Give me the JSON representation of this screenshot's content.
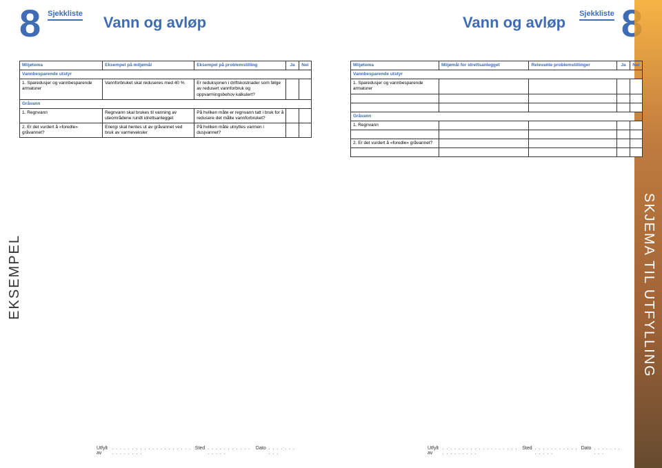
{
  "chapter_number": "8",
  "sjekkliste_label": "Sjekkliste",
  "page_title": "Vann og avløp",
  "vertical_left": "EKSEMPEL",
  "vertical_right": "SKJEMA TIL UTFYLLING",
  "left_table": {
    "headers": {
      "c1": "Miljøtema",
      "c2": "Eksempel på miljømål",
      "c3": "Eksempel på problemstilling",
      "ja": "Ja",
      "nei": "Nei"
    },
    "section1": "Vannbesparende utstyr",
    "rows1": [
      {
        "c1": "1. Sparedusjer og vannbesparende armaturer",
        "c2": "Vannforbruket skal reduseres med 40 %",
        "c3": "Er reduksjonen i driftskostnader som følge av redusert vannforbruk og oppvarmingsbehov kalkulert?"
      }
    ],
    "section2": "Gråvann",
    "rows2": [
      {
        "c1": "1. Regnvann",
        "c2": "Regnvann skal brukes til vanning av uteområdene rundt idrettsanlegget",
        "c3": "På hvilken måte er regnvann tatt i bruk for å redusere det målte vannforbruket?"
      },
      {
        "c1": "2. Er det vurdert å «foredle» gråvannet?",
        "c2": "Energi skal hentes ut av gråvannet ved bruk av varmeveksler",
        "c3": "På hvilken måte utnyttes varmen i dusjvannet?"
      }
    ]
  },
  "right_table": {
    "headers": {
      "c1": "Miljøtema",
      "c2": "Miljømål for idrettsanlegget",
      "c3": "Relevante problemstillinger",
      "ja": "Ja",
      "nei": "Nei"
    },
    "section1": "Vannbesparende utstyr",
    "rows1": [
      {
        "c1": "1. Sparedusjer og vannbesparende armaturer",
        "c2": "",
        "c3": ""
      }
    ],
    "section2": "Gråvann",
    "rows2": [
      {
        "c1": "1. Regnvann",
        "c2": "",
        "c3": ""
      },
      {
        "c1": "2. Er det vurdert å «foredle» gråvannet?",
        "c2": "",
        "c3": ""
      }
    ]
  },
  "footer": {
    "utfylt": "Utfylt av",
    "sted": "Sted",
    "dato": "Dato",
    "dots_long": ". . . . . . . . . . . . . . . . . . . . . . . . . . . .",
    "dots_med": ". . . . . . . . . . . . . . . .",
    "dots_short": ". . . . . . . . . ."
  }
}
